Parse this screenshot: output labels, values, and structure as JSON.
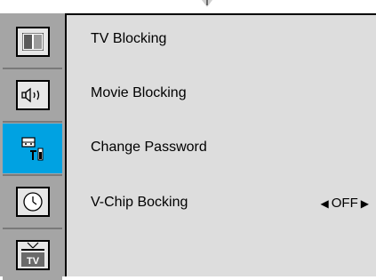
{
  "menu": {
    "items": [
      {
        "label": "TV Blocking"
      },
      {
        "label": "Movie Blocking"
      },
      {
        "label": "Change Password"
      },
      {
        "label": "V-Chip Bocking",
        "value": "OFF"
      }
    ]
  },
  "sidebar": {
    "icons": [
      "picture-icon",
      "sound-icon",
      "setup-icon",
      "clock-icon",
      "tv-icon"
    ],
    "tv_icon_text": "TV"
  },
  "colors": {
    "accent": "#00a2e2",
    "menu_bg": "#dddddd",
    "sidebar_bg": "#a5a5a5"
  }
}
